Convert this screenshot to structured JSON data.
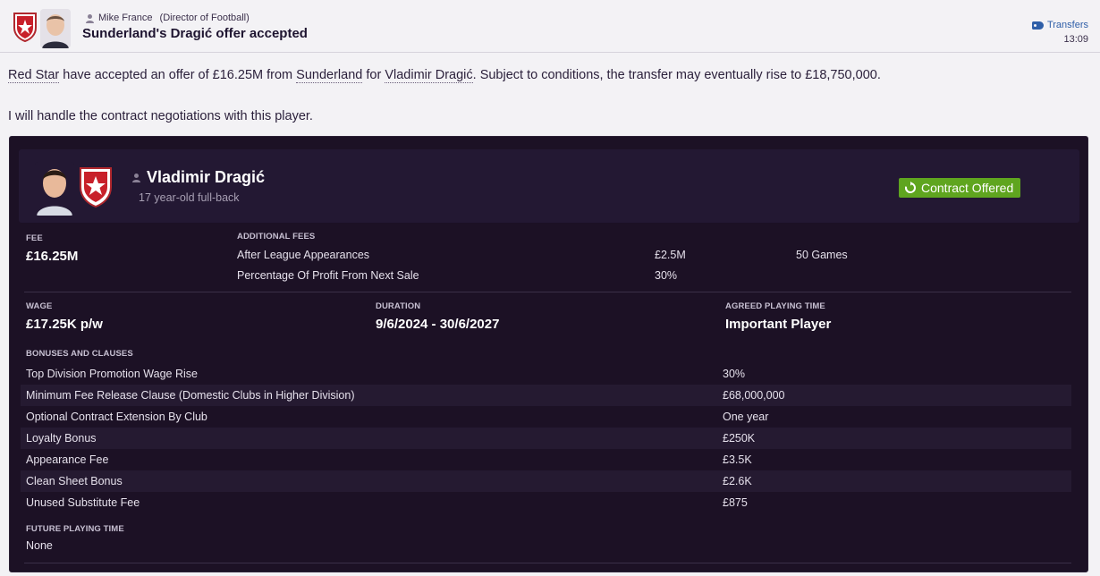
{
  "header": {
    "sender_name": "Mike France",
    "sender_role": "(Director of Football)",
    "subject": "Sunderland's Dragić offer accepted",
    "category": "Transfers",
    "time": "13:09"
  },
  "message": {
    "line1": {
      "club_from": "Red Star",
      "part_a": " have accepted an offer of £16.25M from ",
      "club_to": "Sunderland",
      "part_b": " for ",
      "player": "Vladimir Dragić",
      "part_c": ". Subject to conditions, the transfer may eventually rise to £18,750,000."
    },
    "line2": "I will handle the contract negotiations with this player."
  },
  "player": {
    "name": "Vladimir Dragić",
    "description": "17 year-old full-back",
    "status": "Contract Offered"
  },
  "fee": {
    "label": "FEE",
    "value": "£16.25M",
    "additional_label": "ADDITIONAL FEES",
    "additional": [
      {
        "name": "After League Appearances",
        "amount": "£2.5M",
        "condition": "50 Games"
      },
      {
        "name": "Percentage Of Profit From Next Sale",
        "amount": "30%",
        "condition": ""
      }
    ]
  },
  "contract": {
    "wage_label": "WAGE",
    "wage": "£17.25K p/w",
    "duration_label": "DURATION",
    "duration": "9/6/2024 - 30/6/2027",
    "playing_time_label": "AGREED PLAYING TIME",
    "playing_time": "Important Player"
  },
  "bonuses": {
    "label": "BONUSES AND CLAUSES",
    "rows": [
      {
        "name": "Top Division Promotion Wage Rise",
        "value": "30%"
      },
      {
        "name": "Minimum Fee Release Clause (Domestic Clubs in Higher Division)",
        "value": "£68,000,000"
      },
      {
        "name": "Optional Contract Extension By Club",
        "value": "One year"
      },
      {
        "name": "Loyalty Bonus",
        "value": "£250K"
      },
      {
        "name": "Appearance Fee",
        "value": "£3.5K"
      },
      {
        "name": "Clean Sheet Bonus",
        "value": "£2.6K"
      },
      {
        "name": "Unused Substitute Fee",
        "value": "£875"
      }
    ]
  },
  "future": {
    "label": "FUTURE PLAYING TIME",
    "value": "None"
  },
  "colors": {
    "panel": "#1c1125",
    "status_green": "#5fa51f",
    "link_blue": "#2f5fa8"
  }
}
